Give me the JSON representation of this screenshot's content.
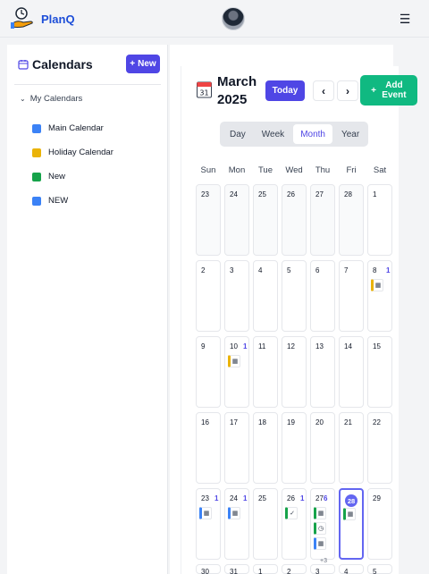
{
  "app": {
    "name": "PlanQ"
  },
  "sidebar": {
    "title": "Calendars",
    "new_label": "New",
    "group_label": "My Calendars",
    "items": [
      {
        "label": "Main Calendar",
        "color": "#3b82f6"
      },
      {
        "label": "Holiday Calendar",
        "color": "#eab308"
      },
      {
        "label": "New",
        "color": "#16a34a"
      },
      {
        "label": "NEW",
        "color": "#3b82f6"
      }
    ]
  },
  "toolbar": {
    "month": "March",
    "year": "2025",
    "today_label": "Today",
    "prev_icon": "‹",
    "next_icon": "›",
    "add_label": "Add Event",
    "add_icon": "+"
  },
  "views": [
    {
      "label": "Day",
      "active": false
    },
    {
      "label": "Week",
      "active": false
    },
    {
      "label": "Month",
      "active": true
    },
    {
      "label": "Year",
      "active": false
    }
  ],
  "weekdays": [
    "Sun",
    "Mon",
    "Tue",
    "Wed",
    "Thu",
    "Fri",
    "Sat"
  ],
  "weeks": [
    [
      {
        "d": "23",
        "out": true
      },
      {
        "d": "24",
        "out": true
      },
      {
        "d": "25",
        "out": true
      },
      {
        "d": "26",
        "out": true
      },
      {
        "d": "27",
        "out": true
      },
      {
        "d": "28",
        "out": true
      },
      {
        "d": "1"
      }
    ],
    [
      {
        "d": "2"
      },
      {
        "d": "3"
      },
      {
        "d": "4"
      },
      {
        "d": "5"
      },
      {
        "d": "6"
      },
      {
        "d": "7"
      },
      {
        "d": "8",
        "badge": "1",
        "events": [
          {
            "color": "#eab308",
            "icon": "calendar-icon",
            "glyph": "▦"
          }
        ]
      }
    ],
    [
      {
        "d": "9"
      },
      {
        "d": "10",
        "badge": "1",
        "events": [
          {
            "color": "#eab308",
            "icon": "calendar-icon",
            "glyph": "▦"
          }
        ]
      },
      {
        "d": "11"
      },
      {
        "d": "12"
      },
      {
        "d": "13"
      },
      {
        "d": "14"
      },
      {
        "d": "15"
      }
    ],
    [
      {
        "d": "16"
      },
      {
        "d": "17"
      },
      {
        "d": "18"
      },
      {
        "d": "19"
      },
      {
        "d": "20"
      },
      {
        "d": "21"
      },
      {
        "d": "22"
      }
    ],
    [
      {
        "d": "23",
        "badge": "1",
        "events": [
          {
            "color": "#3b82f6",
            "icon": "calendar-icon",
            "glyph": "▦"
          }
        ]
      },
      {
        "d": "24",
        "badge": "1",
        "events": [
          {
            "color": "#3b82f6",
            "icon": "calendar-icon",
            "glyph": "▦"
          }
        ]
      },
      {
        "d": "25"
      },
      {
        "d": "26",
        "badge": "1",
        "events": [
          {
            "color": "#16a34a",
            "icon": "check-icon",
            "glyph": "✓"
          }
        ]
      },
      {
        "d": "27",
        "badge": "6",
        "events": [
          {
            "color": "#16a34a",
            "icon": "calendar-icon",
            "glyph": "▦"
          },
          {
            "color": "#16a34a",
            "icon": "alarm-icon",
            "glyph": "◷"
          },
          {
            "color": "#3b82f6",
            "icon": "calendar-icon",
            "glyph": "▦"
          }
        ]
      },
      {
        "d": "28",
        "today": true,
        "events": [
          {
            "color": "#16a34a",
            "icon": "calendar-icon",
            "glyph": "▦"
          }
        ]
      },
      {
        "d": "29"
      }
    ]
  ],
  "more_label": "+3",
  "partial_row": [
    "30",
    "31",
    "1",
    "2",
    "3",
    "4",
    "5"
  ]
}
